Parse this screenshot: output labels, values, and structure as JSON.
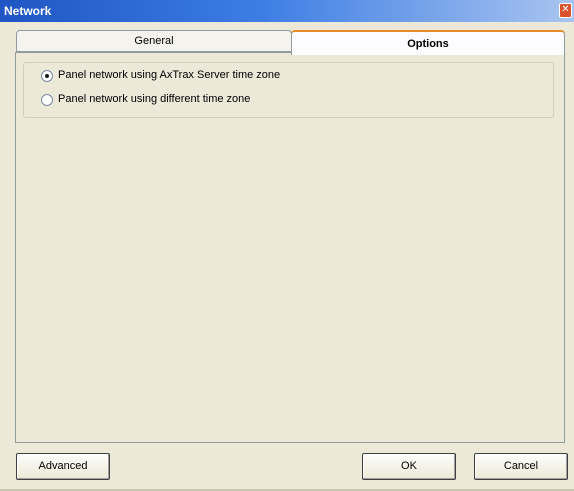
{
  "window": {
    "title": "Network",
    "close_glyph": "✕"
  },
  "tabs": [
    {
      "label": "General",
      "selected": false
    },
    {
      "label": "Options",
      "selected": true
    }
  ],
  "options": {
    "radios": [
      {
        "label": "Panel network using AxTrax Server time zone",
        "checked": true
      },
      {
        "label": "Panel network using different time zone",
        "checked": false
      }
    ]
  },
  "buttons": {
    "advanced": "Advanced",
    "ok": "OK",
    "cancel": "Cancel"
  },
  "colors": {
    "title_bar": "#3c7de4",
    "close_button": "#d9522b",
    "active_tab_highlight": "#e68b2c",
    "background": "#ece9d8"
  }
}
